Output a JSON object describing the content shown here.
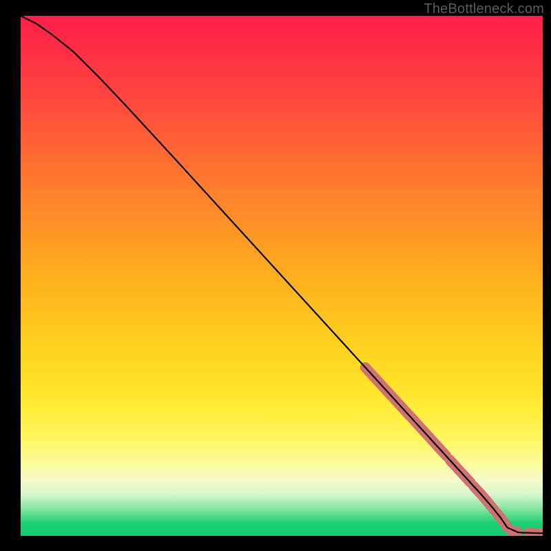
{
  "attribution": "TheBottleneck.com",
  "colors": {
    "dot": "#d17272",
    "line": "#000000"
  },
  "chart_data": {
    "type": "line",
    "title": "",
    "xlabel": "",
    "ylabel": "",
    "xlim": [
      0,
      100
    ],
    "ylim": [
      0,
      100
    ],
    "grid": false,
    "series": [
      {
        "name": "curve",
        "x": [
          0,
          3,
          6,
          10,
          15,
          20,
          30,
          40,
          50,
          60,
          66,
          68,
          70,
          72,
          74,
          76,
          78,
          80,
          82,
          84,
          86,
          88,
          90,
          92,
          93.2,
          95.2,
          96.2,
          98.4,
          100
        ],
        "y": [
          100,
          98.5,
          96.4,
          93.2,
          88.2,
          82.9,
          72,
          61,
          50,
          39,
          32.4,
          30.2,
          28,
          25.8,
          23.6,
          21.4,
          19.2,
          17,
          14.8,
          12.6,
          10.4,
          8.2,
          5.9,
          3.4,
          1.6,
          0.7,
          0.6,
          0.55,
          0.5
        ]
      }
    ],
    "dot_clusters": [
      {
        "x_start": 66,
        "x_end": 74.5,
        "y_start": 32.4,
        "y_end": 23.1
      },
      {
        "x_start": 74.8,
        "x_end": 81.5,
        "y_start": 22.8,
        "y_end": 15.4
      },
      {
        "x_start": 82.2,
        "x_end": 86.2,
        "y_start": 14.6,
        "y_end": 10.2
      },
      {
        "x_start": 86.8,
        "x_end": 88.0,
        "y_start": 9.5,
        "y_end": 8.2
      },
      {
        "x_start": 88.3,
        "x_end": 92.0,
        "y_start": 7.9,
        "y_end": 3.4
      },
      {
        "x_start": 92.3,
        "x_end": 93.2,
        "y_start": 3.0,
        "y_end": 1.7
      },
      {
        "x_start": 94.0,
        "x_end": 95.2,
        "y_start": 0.85,
        "y_end": 0.75
      },
      {
        "x_start": 97.3,
        "x_end": 98.4,
        "y_start": 0.6,
        "y_end": 0.55
      },
      {
        "x_start": 99.35,
        "x_end": 100,
        "y_start": 0.52,
        "y_end": 0.5
      }
    ]
  }
}
